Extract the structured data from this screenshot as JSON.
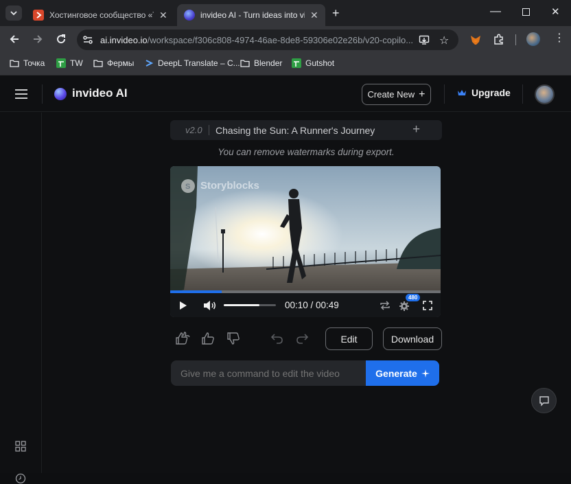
{
  "browser": {
    "tabs": [
      {
        "title": "Хостинговое сообщество «Tim",
        "active": false
      },
      {
        "title": "invideo AI - Turn ideas into vide",
        "active": true
      }
    ],
    "url_domain": "ai.invideo.io",
    "url_path": "/workspace/f306c808-4974-46ae-8de8-59306e02e26b/v20-copilo...",
    "bookmarks": [
      "Точка",
      "TW",
      "Фермы",
      "DeepL Translate – C...",
      "Blender",
      "Gutshot"
    ]
  },
  "app": {
    "brand": "invideo AI",
    "create_new_label": "Create New",
    "upgrade_label": "Upgrade",
    "version_label": "v2.0",
    "project_title": "Chasing the Sun: A Runner's Journey",
    "watermark_notice": "You can remove watermarks during export.",
    "video": {
      "watermark": "Storyblocks",
      "current_time": "00:10",
      "duration": "00:49",
      "time_display": "00:10 / 00:49",
      "quality_badge": "480",
      "progress_fraction": 0.19,
      "volume_fraction": 0.68
    },
    "edit_label": "Edit",
    "download_label": "Download",
    "command_placeholder": "Give me a command to edit the video",
    "generate_label": "Generate"
  },
  "colors": {
    "accent_blue": "#1a73e8",
    "generate_blue": "#1f6feb",
    "background": "#0f1012"
  }
}
